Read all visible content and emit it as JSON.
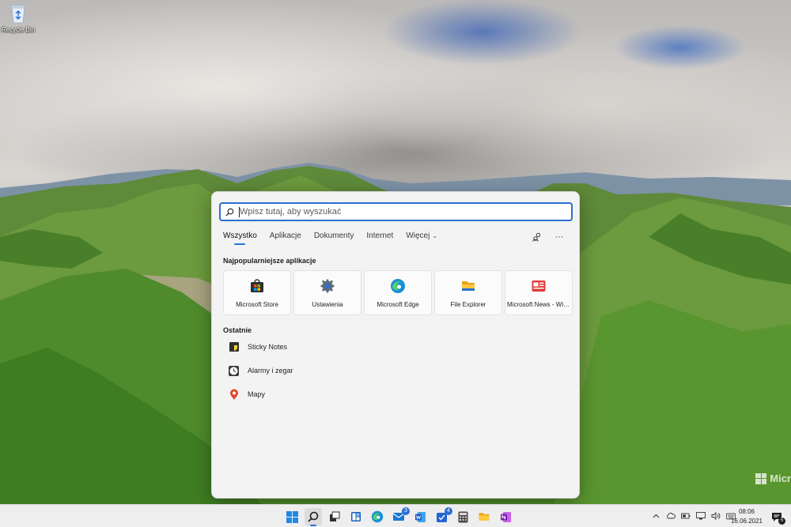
{
  "desktop": {
    "recycle_bin_label": "Recycle Bin",
    "watermark": "Micr"
  },
  "search": {
    "placeholder": "Wpisz tutaj, aby wyszukać",
    "value": ""
  },
  "tabs": [
    {
      "label": "Wszystko",
      "active": true
    },
    {
      "label": "Aplikacje"
    },
    {
      "label": "Dokumenty"
    },
    {
      "label": "Internet"
    },
    {
      "label": "Więcej"
    }
  ],
  "more_chevron": "⌄",
  "tools": {
    "more_icon": "···"
  },
  "top_apps": {
    "title": "Najpopularniejsze aplikacje",
    "items": [
      {
        "label": "Microsoft Store",
        "icon": "store-icon"
      },
      {
        "label": "Ustawienia",
        "icon": "settings-icon"
      },
      {
        "label": "Microsoft Edge",
        "icon": "edge-icon"
      },
      {
        "label": "File Explorer",
        "icon": "folder-icon"
      },
      {
        "label": "Microsoft News - Wia...",
        "icon": "news-icon"
      }
    ]
  },
  "recent": {
    "title": "Ostatnie",
    "items": [
      {
        "label": "Sticky Notes",
        "icon": "sticky-notes-icon"
      },
      {
        "label": "Alarmy i zegar",
        "icon": "alarm-clock-icon"
      },
      {
        "label": "Mapy",
        "icon": "map-pin-icon"
      }
    ]
  },
  "taskbar": {
    "badges": {
      "mail": "3",
      "todo": "4"
    },
    "clock_time": "08:06",
    "clock_date": "16.06.2021",
    "notification_count": "5"
  },
  "colors": {
    "accent": "#2b6fd1",
    "panel_bg": "#f3f3f3",
    "taskbar_bg": "#eeeeee"
  }
}
